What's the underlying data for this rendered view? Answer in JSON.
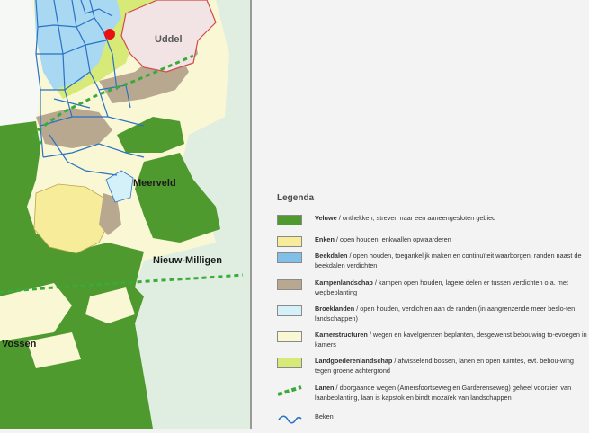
{
  "map": {
    "places": {
      "uddel": "Uddel",
      "meerveld": "Meerveld",
      "nieuw_milligen": "Nieuw-Milligen",
      "vossen": "Vossen"
    },
    "colors": {
      "veluwe": "#4e9a2f",
      "enken": "#f7ec9a",
      "beekdalen": "#7fbfe8",
      "kampen": "#b8a890",
      "broeklanden": "#d4f0f8",
      "kamer": "#f9f7d4",
      "landgoed": "#d7ea78",
      "lanen": "#3aaa3a",
      "beken": "#2a72c4",
      "village": "#f2e4e4",
      "village_border": "#d04a4a",
      "marker": "#e81010",
      "bg_left": "#dfeee0"
    }
  },
  "legend": {
    "title": "Legenda",
    "items": [
      {
        "name": "Veluwe",
        "desc": " / onthekken; streven naar een aaneengesloten gebied",
        "color": "#4e9a2f",
        "type": "fill"
      },
      {
        "name": "Enken",
        "desc": " / open houden, enkwallen opwaarderen",
        "color": "#f7ec9a",
        "type": "fill"
      },
      {
        "name": "Beekdalen",
        "desc": " / open houden, toegankelijk maken en continuïteit waarborgen, randen naast de beekdalen verdichten",
        "color": "#7fbfe8",
        "type": "fill"
      },
      {
        "name": "Kampenlandschap",
        "desc": " / kampen open houden, lagere delen  er tussen verdichten o.a. met wegbeplanting",
        "color": "#b8a890",
        "type": "fill"
      },
      {
        "name": "Broeklanden",
        "desc": " / open houden, verdichten aan de randen (in aangrenzende meer beslo-ten landschappen)",
        "color": "#d4f0f8",
        "type": "fill"
      },
      {
        "name": "Kamerstructuren",
        "desc": " / wegen en kavelgrenzen beplanten, desgewenst bebouwing to-evoegen in kamers",
        "color": "#f9f7d4",
        "type": "fill"
      },
      {
        "name": "Landgoederenlandschap",
        "desc": " / afwisselend bossen, lanen en open ruimtes, evt. bebou-wing tegen groene achtergrond",
        "color": "#d7ea78",
        "type": "fill"
      },
      {
        "name": "Lanen",
        "desc": " / doorgaande wegen (Amersfoortseweg en Garderenseweg) geheel voorzien van laanbeplanting, laan is kapstok en bindt mozaïek van landschappen",
        "color": "#3aaa3a",
        "type": "line"
      },
      {
        "name": "",
        "desc": "Beken",
        "color": "#2a72c4",
        "type": "river"
      }
    ]
  }
}
